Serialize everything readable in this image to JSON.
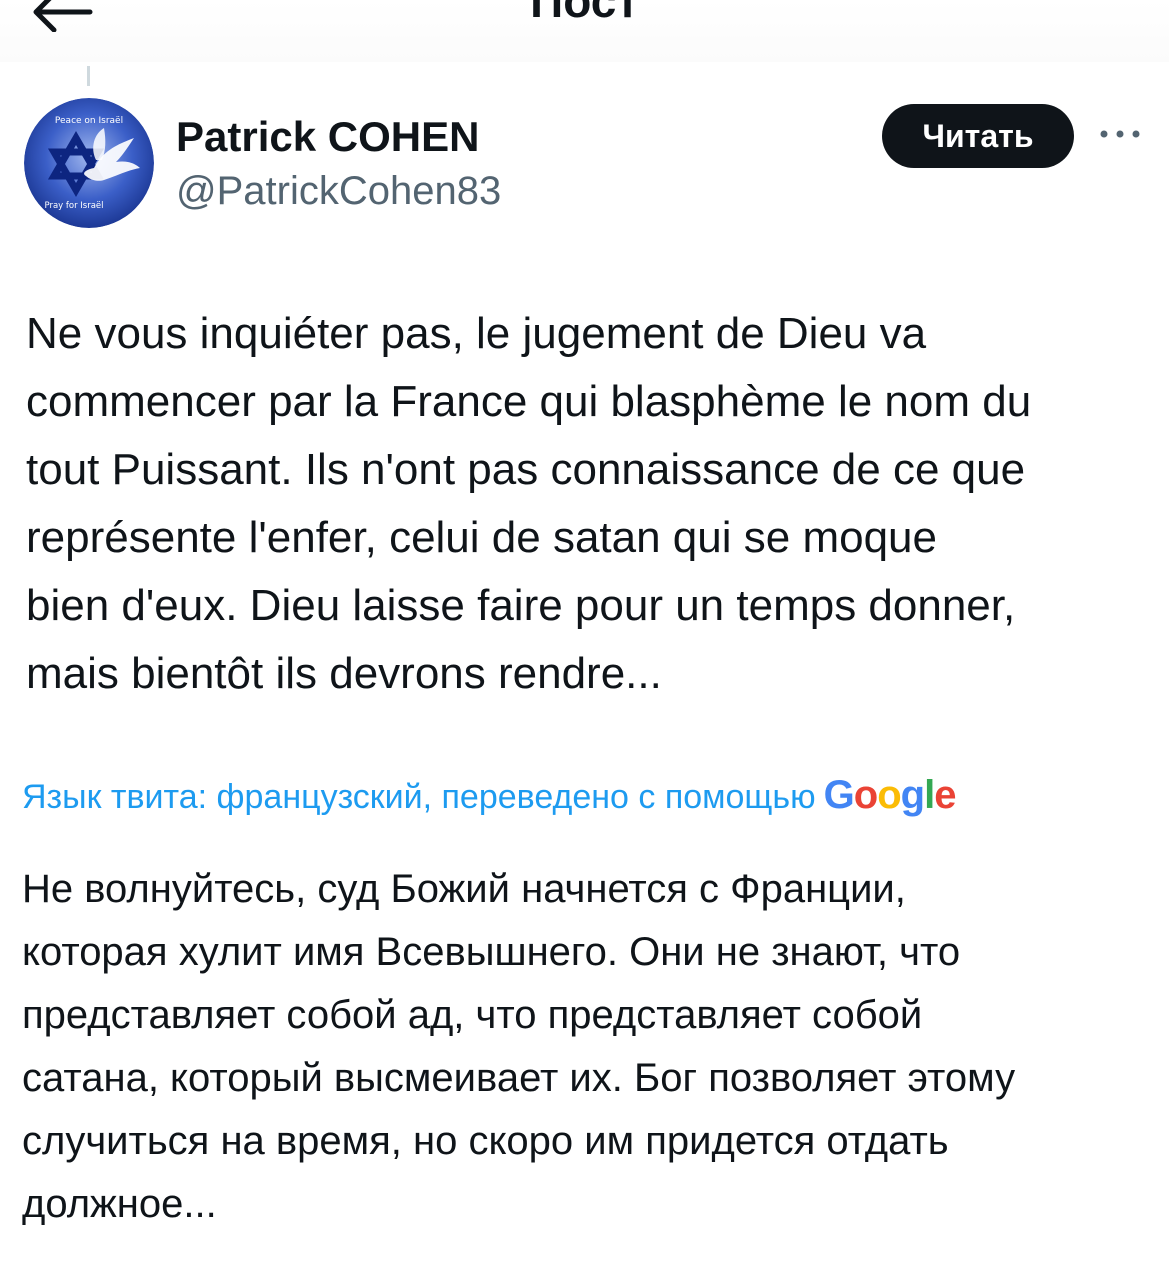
{
  "header": {
    "title": "Пост",
    "back_icon": "arrow-left-icon"
  },
  "author": {
    "display_name": "Patrick COHEN",
    "handle": "@PatrickCohen83",
    "avatar": {
      "top_text": "Peace on Israël",
      "bottom_text": "Pray for Israël",
      "colors": {
        "background": "#1e3fa0",
        "accent": "#ffffff"
      }
    }
  },
  "actions": {
    "follow_label": "Читать",
    "more_icon": "more-horizontal-icon"
  },
  "tweet": {
    "lines": [
      "Ne vous inquiéter pas, le jugement de Dieu va",
      "commencer par la France qui blasphème le nom du",
      "tout Puissant. Ils n'ont pas connaissance de ce que",
      "représente l'enfer, celui de satan qui se moque",
      "bien d'eux. Dieu laisse faire pour un temps donner,",
      "mais bientôt ils devrons rendre..."
    ]
  },
  "translation": {
    "note": "Язык твита: французский, переведено с помощью",
    "provider": [
      "G",
      "o",
      "o",
      "g",
      "l",
      "e"
    ],
    "lines": [
      "Не волнуйтесь, суд Божий начнется с Франции,",
      "которая хулит имя Всевышнего. Они не знают, что",
      "представляет собой ад, что представляет собой",
      "сатана, который высмеивает их. Бог позволяет этому",
      "случиться на время, но скоро им придется отдать",
      "должное..."
    ]
  },
  "colors": {
    "text_primary": "#0f1419",
    "text_secondary": "#536471",
    "link": "#1d9bf0",
    "button_bg": "#0f1419"
  }
}
